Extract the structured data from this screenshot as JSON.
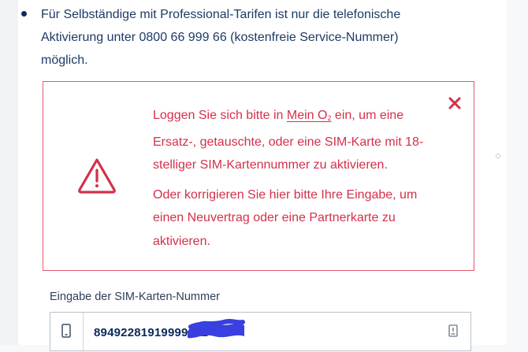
{
  "bullet": {
    "text": "Für Selbständige mit Professional-Tarifen ist nur die telefonische Aktivierung unter 0800 66 999 66 (kostenfreie Service-Nummer) möglich."
  },
  "error": {
    "p1_before": "Loggen Sie sich bitte in ",
    "p1_link": "Mein O",
    "p1_link_sub": "2",
    "p1_after": " ein, um eine Ersatz-, getauschte, oder eine SIM-Karte mit 18-stelliger SIM-Kartennummer zu aktivieren.",
    "p2": "Oder korrigieren Sie hier bitte Ihre Eingabe, um einen Neuvertrag oder eine Partnerkarte zu aktivieren.",
    "close_icon": "close-icon",
    "warning_icon": "warning-triangle-icon",
    "color": "#d4304a"
  },
  "sim": {
    "label": "Eingabe der SIM-Karten-Nummer",
    "value": "89492281919999922",
    "phone_icon": "phone-icon",
    "scan_icon": "sim-scan-icon"
  }
}
